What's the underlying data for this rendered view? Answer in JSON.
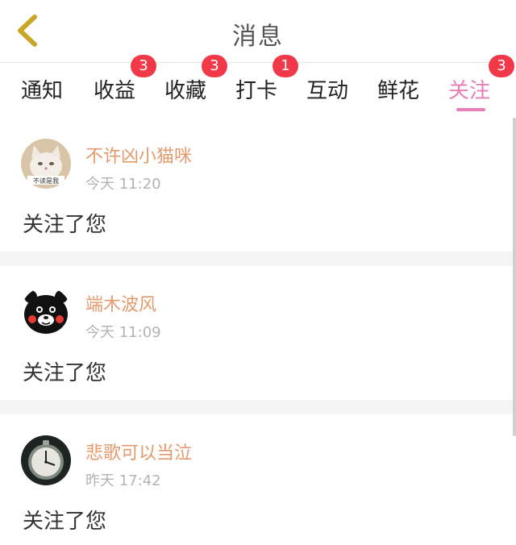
{
  "header": {
    "title": "消息",
    "back_icon": "chevron-left-icon",
    "back_color": "#c9a528"
  },
  "tabs": [
    {
      "label": "通知",
      "badge": null
    },
    {
      "label": "收益",
      "badge": "3"
    },
    {
      "label": "收藏",
      "badge": "3"
    },
    {
      "label": "打卡",
      "badge": "1"
    },
    {
      "label": "互动",
      "badge": null
    },
    {
      "label": "鲜花",
      "badge": null
    },
    {
      "label": "关注",
      "badge": "3",
      "active": true
    }
  ],
  "colors": {
    "accent": "#e87fb4",
    "badge": "#f2394a",
    "username": "#e39a6c"
  },
  "messages": [
    {
      "username": "不许凶小猫咪",
      "time": "今天 11:20",
      "text": "关注了您",
      "avatar": "cat-photo-avatar",
      "avatar_caption": "不读是我"
    },
    {
      "username": "端木波风",
      "time": "今天 11:09",
      "text": "关注了您",
      "avatar": "kumamon-avatar"
    },
    {
      "username": "悲歌可以当泣",
      "time": "昨天 17:42",
      "text": "关注了您",
      "avatar": "pocket-watch-avatar"
    }
  ]
}
